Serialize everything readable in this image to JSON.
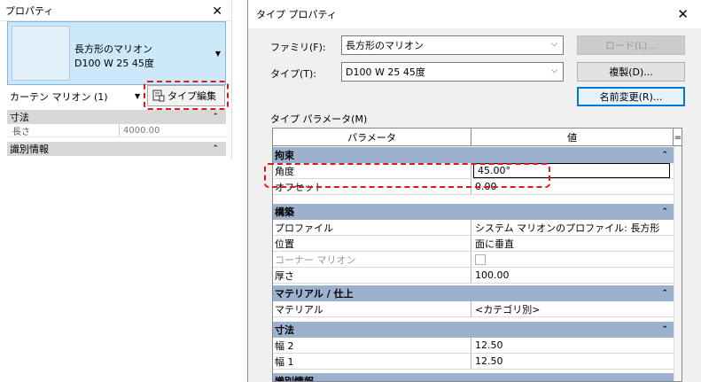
{
  "palette": {
    "title": "プロパティ",
    "type_name_line1": "長方形のマリオン",
    "type_name_line2": "D100 W 25 45度",
    "instance_filter": "カーテン マリオン (1)",
    "edit_type_label": "タイプ編集",
    "sections": [
      {
        "label": "寸法",
        "rows": [
          {
            "key": "長さ",
            "value": "4000.00"
          }
        ]
      },
      {
        "label": "識別情報",
        "rows": []
      }
    ]
  },
  "dialog": {
    "title": "タイプ プロパティ",
    "family_label": "ファミリ(F):",
    "family_value": "長方形のマリオン",
    "type_label": "タイプ(T):",
    "type_value": "D100 W 25 45度",
    "load_button": "ロード(L)...",
    "duplicate_button": "複製(D)...",
    "rename_button": "名前変更(R)...",
    "params_label": "タイプ パラメータ(M)",
    "grid_headers": {
      "param": "パラメータ",
      "value": "値"
    },
    "sections": [
      {
        "label": "拘束",
        "rows": [
          {
            "key": "角度",
            "value": "45.00°"
          },
          {
            "key": "オフセット",
            "value": "0.00"
          }
        ]
      },
      {
        "label": "構築",
        "rows": [
          {
            "key": "プロファイル",
            "value": "システム マリオンのプロファイル: 長方形"
          },
          {
            "key": "位置",
            "value": "面に垂直"
          },
          {
            "key": "コーナー マリオン",
            "value": ""
          },
          {
            "key": "厚さ",
            "value": "100.00"
          }
        ]
      },
      {
        "label": "マテリアル / 仕上",
        "rows": [
          {
            "key": "マテリアル",
            "value": "<カテゴリ別>"
          }
        ]
      },
      {
        "label": "寸法",
        "rows": [
          {
            "key": "幅 2",
            "value": "12.50"
          },
          {
            "key": "幅 1",
            "value": "12.50"
          }
        ]
      },
      {
        "label": "識別情報",
        "rows": []
      }
    ]
  },
  "colors": {
    "highlight": "#e0161b",
    "section_header": "#9bb1ce",
    "selection": "#cde8f8"
  }
}
